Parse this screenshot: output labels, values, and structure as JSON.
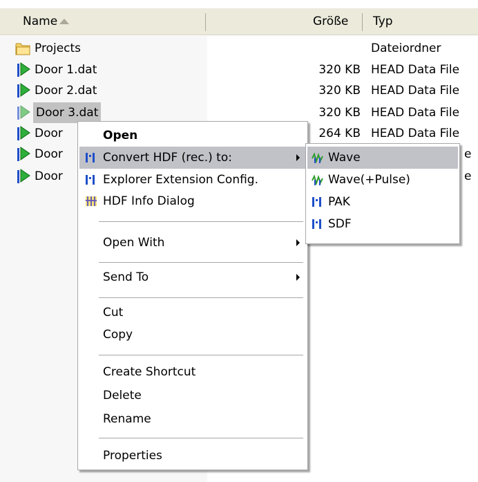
{
  "columns": {
    "name": "Name",
    "size": "Größe",
    "type": "Typ"
  },
  "files": [
    {
      "name": "Projects",
      "size": "",
      "type": "Dateiordner",
      "icon": "folder-icon"
    },
    {
      "name": "Door 1.dat",
      "size": "320 KB",
      "type": "HEAD Data File",
      "icon": "head-data-file-icon"
    },
    {
      "name": "Door 2.dat",
      "size": "320 KB",
      "type": "HEAD Data File",
      "icon": "head-data-file-icon"
    },
    {
      "name": "Door 3.dat",
      "size": "320 KB",
      "type": "HEAD Data File",
      "icon": "head-data-file-icon",
      "selected": true
    },
    {
      "name": "Door",
      "size": "264 KB",
      "type": "HEAD Data File",
      "icon": "head-data-file-icon"
    },
    {
      "name": "Door",
      "size": "",
      "type": "e",
      "icon": "head-data-file-icon"
    },
    {
      "name": "Door",
      "size": "",
      "type": "e",
      "icon": "head-data-file-icon"
    }
  ],
  "context_menu": {
    "open": "Open",
    "convert": "Convert HDF (rec.) to:",
    "explorer_config": "Explorer Extension Config.",
    "hdf_info": "HDF Info Dialog",
    "open_with": "Open With",
    "send_to": "Send To",
    "cut": "Cut",
    "copy": "Copy",
    "create_shortcut": "Create Shortcut",
    "delete": "Delete",
    "rename": "Rename",
    "properties": "Properties"
  },
  "submenu": {
    "wave": "Wave",
    "wave_pulse": "Wave(+Pulse)",
    "pak": "PAK",
    "sdf": "SDF"
  },
  "colors": {
    "header_bg": "#ebeadb",
    "selection_gray": "#c2c2c2",
    "menu_highlight": "#c1c1c8",
    "icon_green": "#2e9e2e",
    "icon_blue": "#1f4fc8"
  }
}
